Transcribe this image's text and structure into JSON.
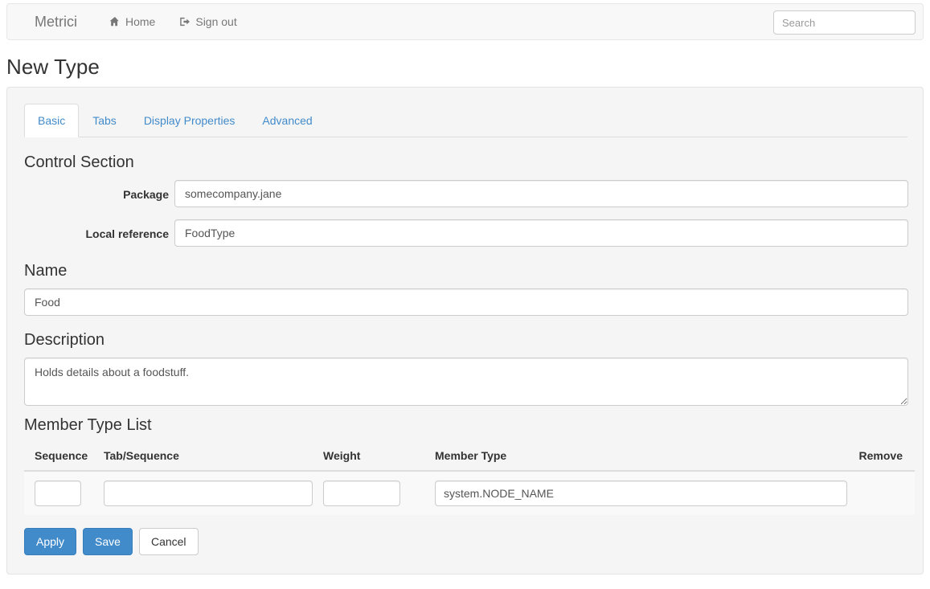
{
  "navbar": {
    "brand": "Metrici",
    "links": [
      {
        "label": "Home",
        "icon": "home-icon"
      },
      {
        "label": "Sign out",
        "icon": "sign-out-icon"
      }
    ],
    "search_placeholder": "Search",
    "search_value": ""
  },
  "page": {
    "title": "New Type"
  },
  "tabs": [
    {
      "label": "Basic",
      "active": true
    },
    {
      "label": "Tabs",
      "active": false
    },
    {
      "label": "Display Properties",
      "active": false
    },
    {
      "label": "Advanced",
      "active": false
    }
  ],
  "control_section": {
    "heading": "Control Section",
    "package": {
      "label": "Package",
      "value": "somecompany.jane"
    },
    "local_reference": {
      "label": "Local reference",
      "value": "FoodType"
    }
  },
  "name_section": {
    "heading": "Name",
    "value": "Food"
  },
  "description_section": {
    "heading": "Description",
    "value": "Holds details about a foodstuff."
  },
  "member_type_list": {
    "heading": "Member Type List",
    "columns": [
      "Sequence",
      "Tab/Sequence",
      "Weight",
      "Member Type",
      "Remove"
    ],
    "rows": [
      {
        "sequence": "",
        "tab_sequence": "",
        "weight": "",
        "member_type": "system.NODE_NAME",
        "remove": ""
      }
    ]
  },
  "buttons": {
    "apply": "Apply",
    "save": "Save",
    "cancel": "Cancel"
  },
  "colors": {
    "primary": "#428bca",
    "panel_bg": "#f5f5f5",
    "navbar_bg": "#f8f8f8",
    "border": "#dddddd",
    "text": "#333333",
    "muted": "#777777"
  }
}
